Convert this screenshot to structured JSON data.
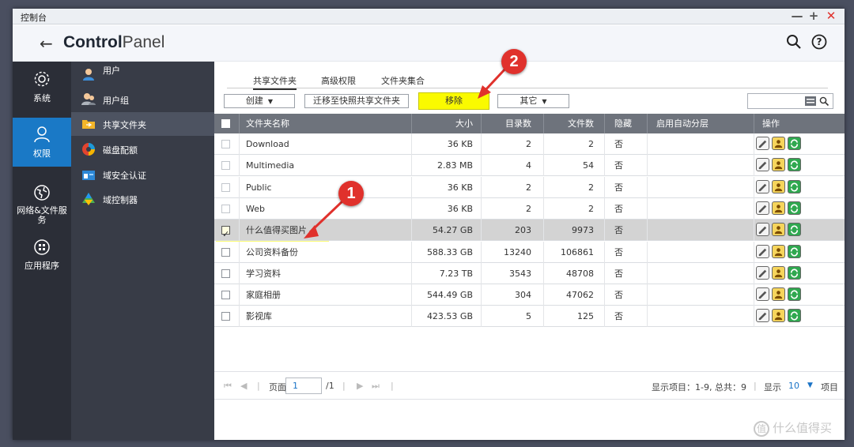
{
  "window": {
    "title": "控制台"
  },
  "header": {
    "brand_bold": "Control",
    "brand_light": "Panel"
  },
  "sidebar": [
    {
      "label": "系统",
      "icon": "gear-icon"
    },
    {
      "label": "权限",
      "icon": "user-icon"
    },
    {
      "label": "网络&文件服务",
      "icon": "globe-icon"
    },
    {
      "label": "应用程序",
      "icon": "apps-icon"
    }
  ],
  "subnav": [
    {
      "label": "用户",
      "icon": "user-icon"
    },
    {
      "label": "用户组",
      "icon": "user-group-icon"
    },
    {
      "label": "共享文件夹",
      "icon": "folder-icon"
    },
    {
      "label": "磁盘配额",
      "icon": "disk-quota-icon"
    },
    {
      "label": "域安全认证",
      "icon": "domain-security-icon"
    },
    {
      "label": "域控制器",
      "icon": "domain-controller-icon"
    }
  ],
  "tabs": [
    "共享文件夹",
    "高级权限",
    "文件夹集合"
  ],
  "toolbar": {
    "create": "创建",
    "migrate": "迁移至快照共享文件夹",
    "remove": "移除",
    "other": "其它"
  },
  "table": {
    "columns": [
      "文件夹名称",
      "大小",
      "目录数",
      "文件数",
      "隐藏",
      "启用自动分层",
      "操作"
    ],
    "rows": [
      {
        "name": "Download",
        "size": "36 KB",
        "dirs": "2",
        "files": "2",
        "hidden": "否",
        "checked": false,
        "light": true
      },
      {
        "name": "Multimedia",
        "size": "2.83 MB",
        "dirs": "4",
        "files": "54",
        "hidden": "否",
        "checked": false,
        "light": true
      },
      {
        "name": "Public",
        "size": "36 KB",
        "dirs": "2",
        "files": "2",
        "hidden": "否",
        "checked": false,
        "light": true
      },
      {
        "name": "Web",
        "size": "36 KB",
        "dirs": "2",
        "files": "2",
        "hidden": "否",
        "checked": false,
        "light": true
      },
      {
        "name": "什么值得买图片",
        "size": "54.27 GB",
        "dirs": "203",
        "files": "9973",
        "hidden": "否",
        "checked": true,
        "light": false
      },
      {
        "name": "公司资料备份",
        "size": "588.33 GB",
        "dirs": "13240",
        "files": "106861",
        "hidden": "否",
        "checked": false,
        "light": false
      },
      {
        "name": "学习资料",
        "size": "7.23 TB",
        "dirs": "3543",
        "files": "48708",
        "hidden": "否",
        "checked": false,
        "light": false
      },
      {
        "name": "家庭相册",
        "size": "544.49 GB",
        "dirs": "304",
        "files": "47062",
        "hidden": "否",
        "checked": false,
        "light": false
      },
      {
        "name": "影视库",
        "size": "423.53 GB",
        "dirs": "5",
        "files": "125",
        "hidden": "否",
        "checked": false,
        "light": false
      }
    ]
  },
  "pager": {
    "page_label": "页面",
    "page": "1",
    "total": "/1",
    "summary": "显示项目：1-9, 总共：9",
    "show_label": "显示",
    "per_page": "10",
    "items_label": "项目"
  },
  "badges": [
    "1",
    "2"
  ],
  "watermark": "什么值得买",
  "colors": {
    "highlight": "#fafa00",
    "badge": "#e0312c",
    "accent": "#1a79c6",
    "sidebar": "#2b2e37"
  }
}
